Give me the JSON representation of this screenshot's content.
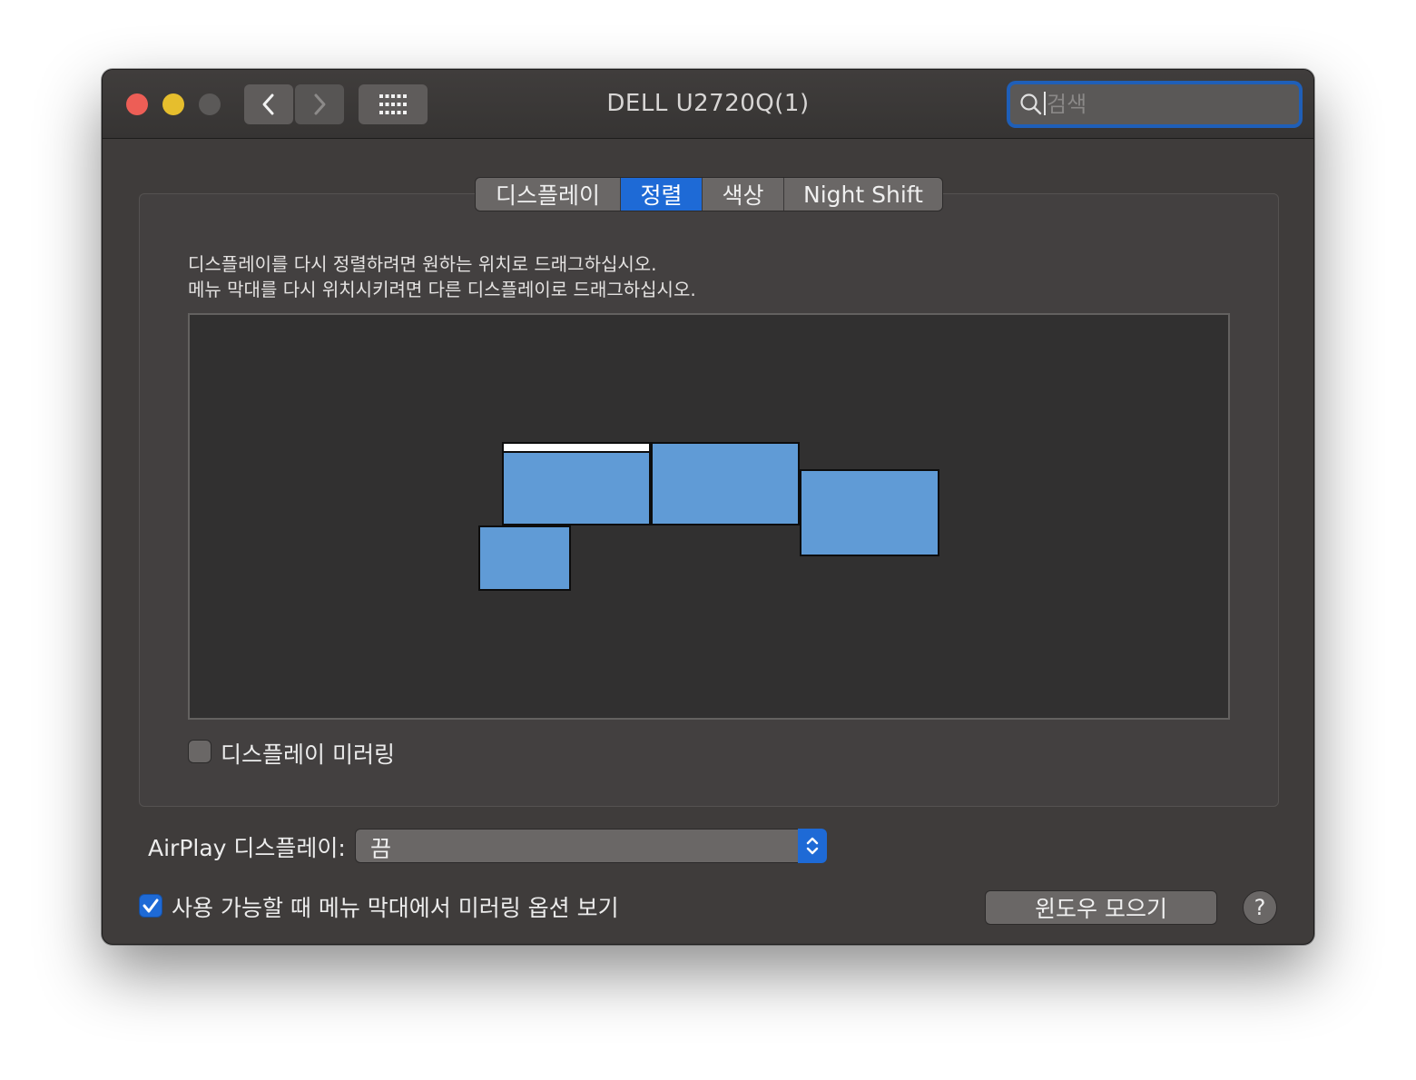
{
  "window": {
    "title": "DELL U2720Q(1)"
  },
  "toolbar": {
    "back_icon": "chevron-left-icon",
    "forward_icon": "chevron-right-icon",
    "show_all_icon": "grid-icon",
    "search": {
      "placeholder": "검색",
      "value": ""
    }
  },
  "tabs": [
    {
      "label": "디스플레이",
      "active": false
    },
    {
      "label": "정렬",
      "active": true
    },
    {
      "label": "색상",
      "active": false
    },
    {
      "label": "Night Shift",
      "active": false
    }
  ],
  "arrangement": {
    "instruction_line1": "디스플레이를 다시 정렬하려면 원하는 위치로 드래그하십시오.",
    "instruction_line2": "메뉴 막대를 다시 위치시키려면 다른 디스플레이로 드래그하십시오.",
    "display_count": 4,
    "display_color": "#609bd6",
    "menu_bar_display_index": 1
  },
  "mirror": {
    "label": "디스플레이 미러링",
    "checked": false
  },
  "airplay": {
    "label": "AirPlay 디스플레이:",
    "selected": "끔"
  },
  "show_mirroring": {
    "label": "사용 가능할 때 메뉴 막대에서 미러링 옵션 보기",
    "checked": true
  },
  "buttons": {
    "gather_windows": "윈도우 모으기",
    "help": "?"
  },
  "colors": {
    "accent": "#1e6ad6",
    "close": "#ed5e56",
    "minimize": "#e6be2d",
    "zoom_disabled": "#5b5958"
  }
}
